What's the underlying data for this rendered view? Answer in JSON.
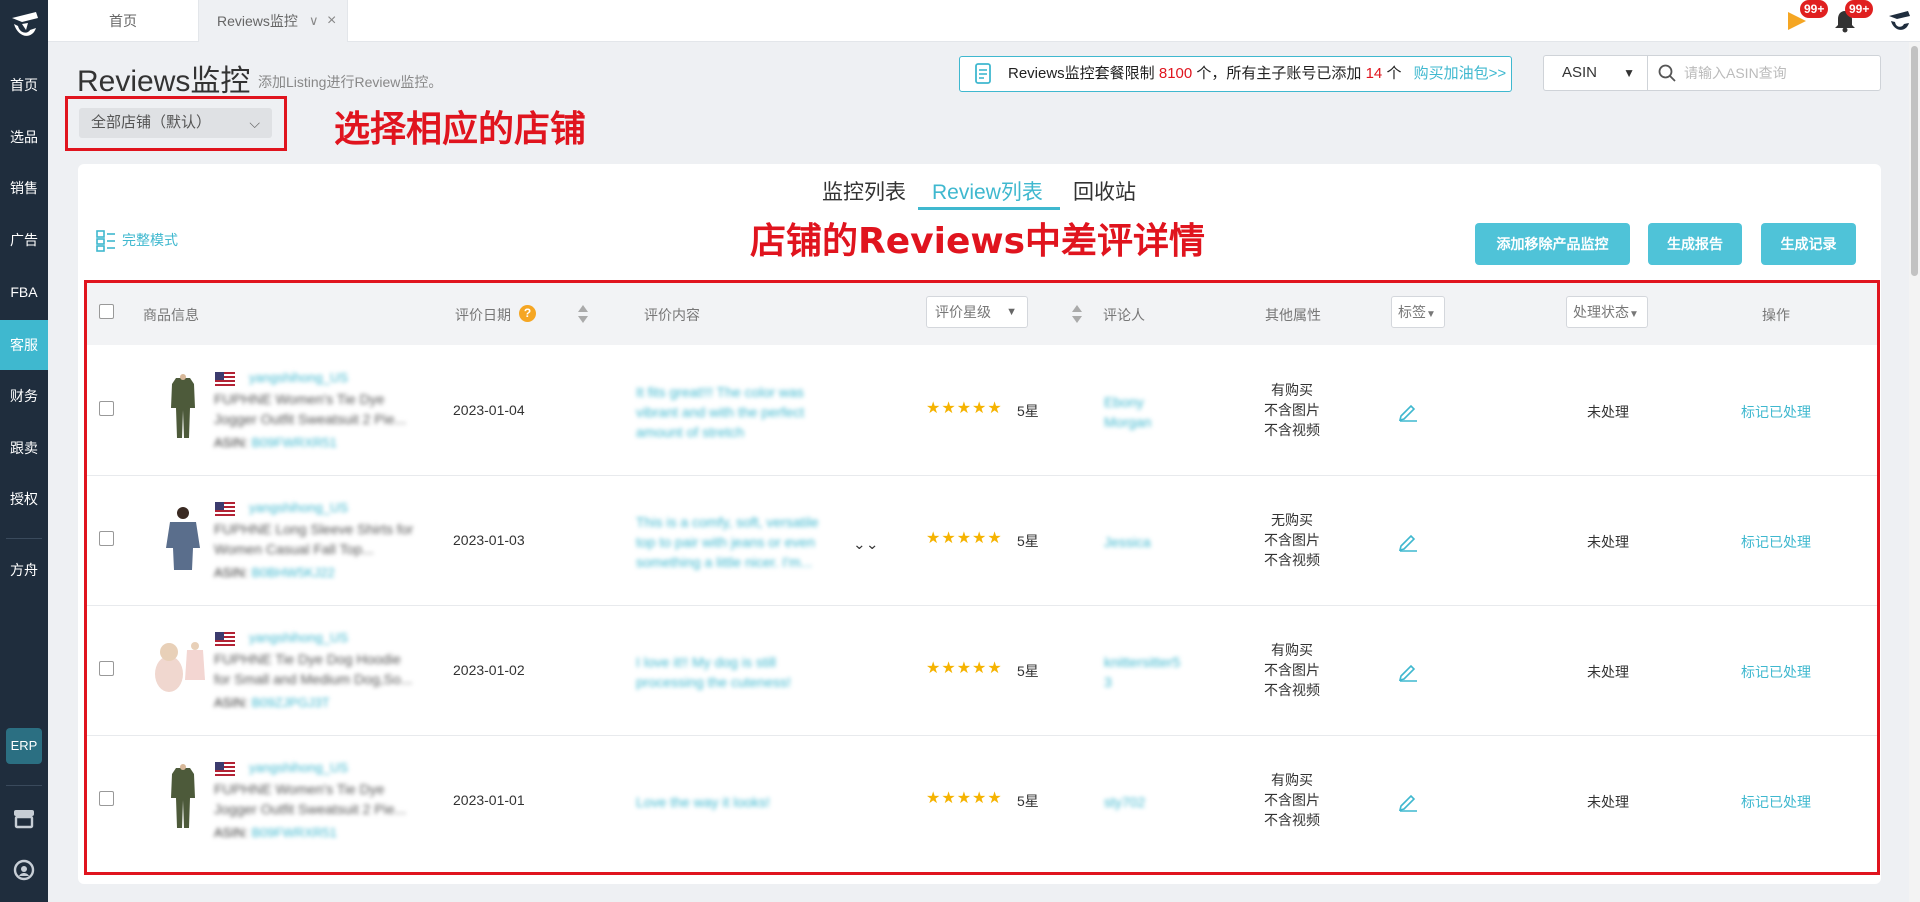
{
  "sidebar": {
    "items": [
      {
        "label": "首页",
        "active": false
      },
      {
        "label": "选品",
        "active": false
      },
      {
        "label": "销售",
        "active": false
      },
      {
        "label": "广告",
        "active": false
      },
      {
        "label": "FBA",
        "active": false
      },
      {
        "label": "客服",
        "active": true
      },
      {
        "label": "财务",
        "active": false
      },
      {
        "label": "跟卖",
        "active": false
      },
      {
        "label": "授权",
        "active": false
      },
      {
        "label": "方舟",
        "active": false
      }
    ],
    "erp_label": "ERP"
  },
  "tabs": {
    "home": "首页",
    "current": "Reviews监控",
    "current_dropdown": "∨",
    "current_close": "×"
  },
  "badges": {
    "flag": "99+",
    "bell": "99+"
  },
  "header": {
    "title": "Reviews监控",
    "subtitle": "添加Listing进行Review监控。",
    "store_select": "全部店铺（默认）",
    "store_chevron": "⌵"
  },
  "annotations": {
    "select_store": "选择相应的店铺",
    "bad_reviews": "店铺的Reviews中差评详情"
  },
  "quota": {
    "prefix": "Reviews监控套餐限制",
    "limit": "8100",
    "middle": "个，所有主子账号已添加",
    "added": "14",
    "suffix": "个",
    "link": "购买加油包>>"
  },
  "search": {
    "type": "ASIN",
    "placeholder": "请输入ASIN查询"
  },
  "subtabs": [
    "监控列表",
    "Review列表",
    "回收站"
  ],
  "view_mode": "完整模式",
  "actions": [
    "添加移除产品监控",
    "生成报告",
    "生成记录"
  ],
  "table": {
    "headers": {
      "product": "商品信息",
      "date": "评价日期",
      "help": "?",
      "content": "评价内容",
      "rating": "评价星级",
      "reviewer": "评论人",
      "attrs": "其他属性",
      "tag": "标签",
      "status": "处理状态",
      "ops": "操作"
    },
    "rows": [
      {
        "store": "yangshihong_US",
        "title_1": "FUPHNE Women's Tie Dye",
        "title_2": "Jogger Outfit Sweatsuit 2 Pie...",
        "asin_label": "ASIN:",
        "asin": "B09FWRXR51",
        "date": "2023-01-04",
        "review_1": "It fits great!!! The color was",
        "review_2": "vibrant and with the perfect",
        "review_3": "amount of stretch",
        "stars": "★★★★★",
        "star_label": "5星",
        "reviewer_1": "Ebony",
        "reviewer_2": "Morgan",
        "attr_purchase": "有购买",
        "attr_image": "不含图片",
        "attr_video": "不含视频",
        "status": "未处理",
        "action": "标记已处理"
      },
      {
        "store": "yangshihong_US",
        "title_1": "FUPHNE Long Sleeve Shirts for",
        "title_2": "Women Casual Fall Top...",
        "asin_label": "ASIN:",
        "asin": "B0BHW5KJ22",
        "date": "2023-01-03",
        "review_1": "This is a comfy, soft, versatile",
        "review_2": "top to pair with jeans or even",
        "review_3": "something a little nicer. I'm...",
        "expand": "⌄⌄",
        "stars": "★★★★★",
        "star_label": "5星",
        "reviewer_1": "Jessica",
        "reviewer_2": "",
        "attr_purchase": "无购买",
        "attr_image": "不含图片",
        "attr_video": "不含视频",
        "status": "未处理",
        "action": "标记已处理"
      },
      {
        "store": "yangshihong_US",
        "title_1": "FUPHNE Tie Dye Dog Hoodie",
        "title_2": "for Small and Medium Dog,So...",
        "asin_label": "ASIN:",
        "asin": "B09ZJPGJ3T",
        "date": "2023-01-02",
        "review_1": "I love it!! My dog is still",
        "review_2": "processing the cuteness!",
        "review_3": "",
        "stars": "★★★★★",
        "star_label": "5星",
        "reviewer_1": "knittersitter5",
        "reviewer_2": "3",
        "attr_purchase": "有购买",
        "attr_image": "不含图片",
        "attr_video": "不含视频",
        "status": "未处理",
        "action": "标记已处理"
      },
      {
        "store": "yangshihong_US",
        "title_1": "FUPHNE Women's Tie Dye",
        "title_2": "Jogger Outfit Sweatsuit 2 Pie...",
        "asin_label": "ASIN:",
        "asin": "B09FWRXR51",
        "date": "2023-01-01",
        "review_1": "Love the way it looks!",
        "review_2": "",
        "review_3": "",
        "stars": "★★★★★",
        "star_label": "5星",
        "reviewer_1": "sty702",
        "reviewer_2": "",
        "attr_purchase": "有购买",
        "attr_image": "不含图片",
        "attr_video": "不含视频",
        "status": "未处理",
        "action": "标记已处理"
      }
    ]
  },
  "colors": {
    "accent": "#3fb8cf",
    "sidebar_bg": "#1f2d3d",
    "annotation_red": "#e0141e",
    "star": "#f5b301"
  }
}
